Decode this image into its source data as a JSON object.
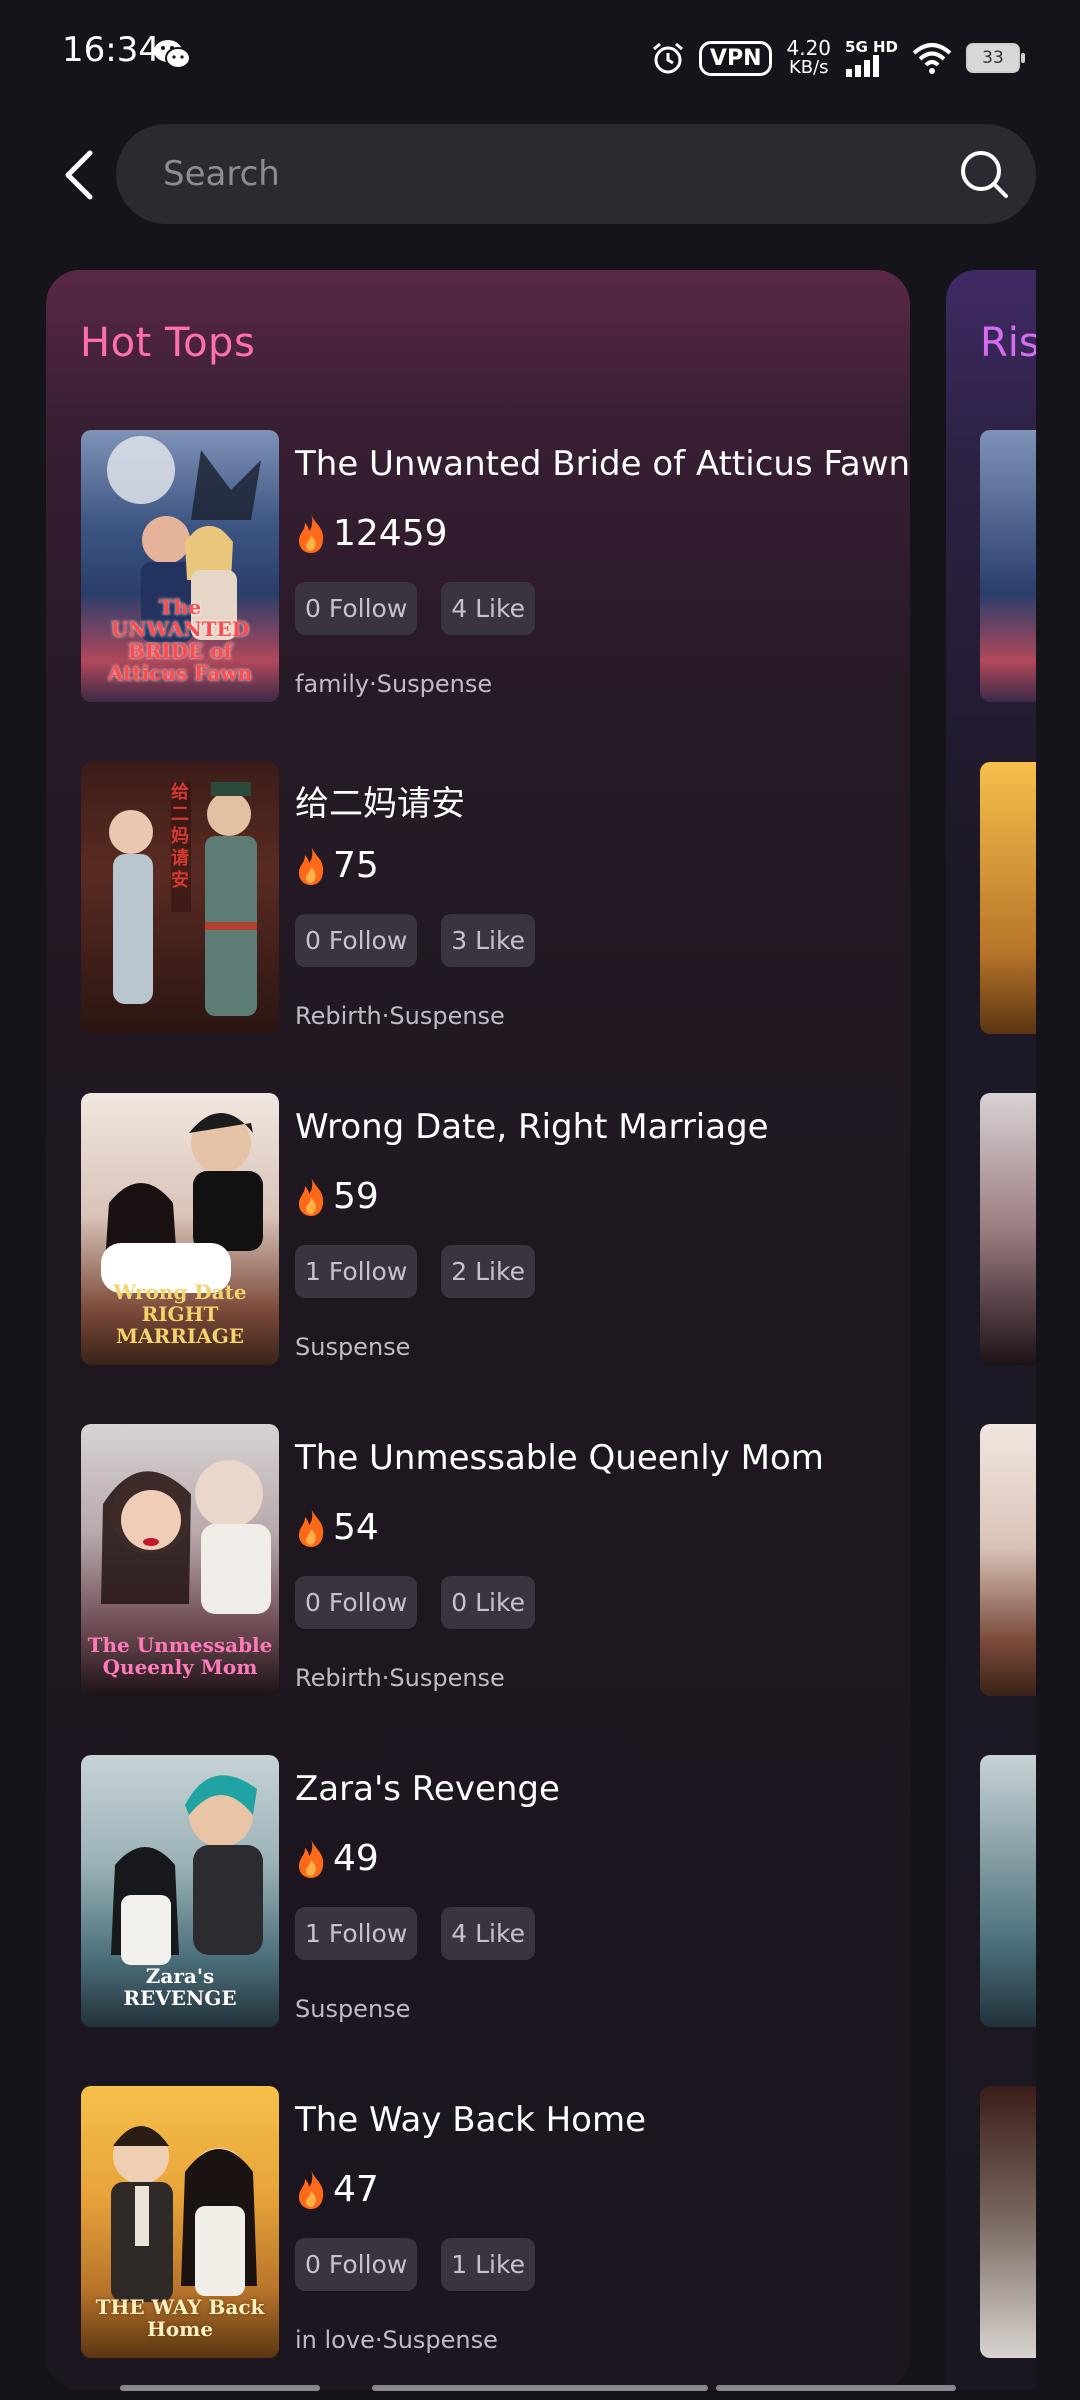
{
  "status_bar": {
    "time": "16:34",
    "vpn": "VPN",
    "speed_value": "4.20",
    "speed_unit": "KB/s",
    "network": "5G HD",
    "battery": "33"
  },
  "search": {
    "placeholder": "Search"
  },
  "hot_tops": {
    "title": "Hot Tops",
    "items": [
      {
        "title": "The Unwanted Bride of Atticus Fawn",
        "heat": "12459",
        "follow": "0 Follow",
        "like": "4 Like",
        "tags": "family·Suspense",
        "poster_text": "The UNWANTED BRIDE of Atticus Fawn"
      },
      {
        "title": "给二妈请安",
        "heat": "75",
        "follow": "0 Follow",
        "like": "3 Like",
        "tags": "Rebirth·Suspense",
        "poster_text": "给二妈请安"
      },
      {
        "title": "Wrong Date, Right Marriage",
        "heat": "59",
        "follow": "1 Follow",
        "like": "2 Like",
        "tags": "Suspense",
        "poster_text": "Wrong Date RIGHT MARRIAGE"
      },
      {
        "title": "The Unmessable Queenly Mom",
        "heat": "54",
        "follow": "0 Follow",
        "like": "0 Like",
        "tags": "Rebirth·Suspense",
        "poster_text": "The Unmessable Queenly Mom"
      },
      {
        "title": "Zara's Revenge",
        "heat": "49",
        "follow": "1 Follow",
        "like": "4 Like",
        "tags": "Suspense",
        "poster_text": "Zara's REVENGE"
      },
      {
        "title": "The Way Back Home",
        "heat": "47",
        "follow": "0 Follow",
        "like": "1 Like",
        "tags": "in love·Suspense",
        "poster_text": "THE WAY Back Home"
      }
    ]
  },
  "rising": {
    "title": "Ris"
  },
  "colors": {
    "accent_pink": "#ff6fb0",
    "accent_purple": "#d66cf0",
    "fire": "#ff6a1a"
  }
}
